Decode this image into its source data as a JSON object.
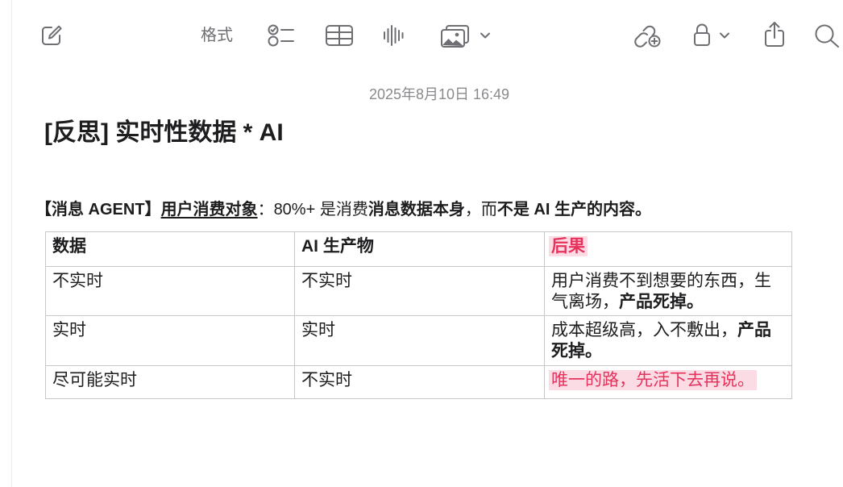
{
  "toolbar": {
    "format_label": "格式",
    "icons": {
      "compose": "compose-icon",
      "checklist": "checklist-icon",
      "table": "table-icon",
      "audio": "audio-waveform-icon",
      "media": "photo-media-icon",
      "media_menu": "chevron-down-icon",
      "collaborate": "collaborate-link-icon",
      "lock": "lock-icon",
      "lock_menu": "chevron-down-icon",
      "share": "share-icon",
      "search": "search-icon"
    }
  },
  "colors": {
    "text": "#1d1d1f",
    "muted": "#8a8a8e",
    "icon": "#6e6e73",
    "accent_red": "#e5335d",
    "highlight_pink": "#fcdce4",
    "table_border": "#c8c8cc"
  },
  "note": {
    "date": "2025年8月10日 16:49",
    "title": "[反思] 实时性数据 * AI",
    "intro": {
      "tag": "【消息 AGENT】",
      "subject": "用户消费对象",
      "colon": "：",
      "stat": "80%+ 是消费",
      "focus": "消息数据本身",
      "comma": "，而",
      "contrast": "不是 AI 生产的内容。"
    },
    "table": {
      "headers": {
        "data": "数据",
        "ai_output": "AI 生产物",
        "consequence": "后果"
      },
      "rows": [
        {
          "data": "不实时",
          "ai_output": "不实时",
          "consequence": {
            "plain": "用户消费不到想要的东西，生气离场，",
            "bold": "产品死掉。"
          }
        },
        {
          "data": "实时",
          "ai_output": "实时",
          "consequence": {
            "plain": "成本超级高，入不敷出，",
            "bold": "产品死掉。"
          }
        },
        {
          "data": "尽可能实时",
          "ai_output": "不实时",
          "consequence": {
            "highlight": "唯一的路，先活下去再说。"
          }
        }
      ]
    }
  }
}
